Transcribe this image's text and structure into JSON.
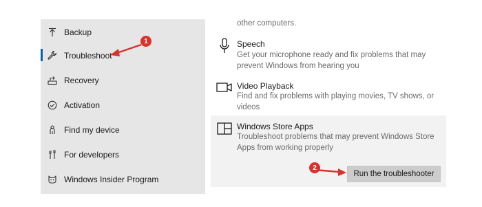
{
  "sidebar": {
    "items": [
      {
        "label": "Backup",
        "icon": "backup-arrow-icon"
      },
      {
        "label": "Troubleshoot",
        "icon": "wrench-icon",
        "selected": true
      },
      {
        "label": "Recovery",
        "icon": "recovery-icon"
      },
      {
        "label": "Activation",
        "icon": "checkmark-circle-icon"
      },
      {
        "label": "Find my device",
        "icon": "person-location-icon"
      },
      {
        "label": "For developers",
        "icon": "developer-tools-icon"
      },
      {
        "label": "Windows Insider Program",
        "icon": "insider-cat-icon"
      }
    ],
    "accent_color": "#0063b1"
  },
  "content": {
    "truncated_desc": "other computers.",
    "tools": [
      {
        "title": "Speech",
        "desc": "Get your microphone ready and fix problems that may prevent Windows from hearing you",
        "icon": "microphone-icon"
      },
      {
        "title": "Video Playback",
        "desc": "Find and fix problems with playing movies, TV shows, or videos",
        "icon": "video-camera-icon"
      },
      {
        "title": "Windows Store Apps",
        "desc": "Troubleshoot problems that may prevent Windows Store Apps from working properly",
        "icon": "store-apps-icon",
        "selected": true
      }
    ],
    "run_button_label": "Run the troubleshooter"
  },
  "annotations": {
    "badge_1": "1",
    "badge_2": "2",
    "color": "#d9312b"
  }
}
